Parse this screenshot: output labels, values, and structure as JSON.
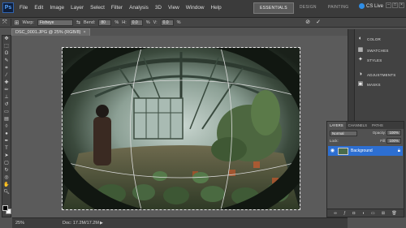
{
  "app": {
    "logo": "Ps"
  },
  "menu": [
    "File",
    "Edit",
    "Image",
    "Layer",
    "Select",
    "Filter",
    "Analysis",
    "3D",
    "View",
    "Window",
    "Help"
  ],
  "appbar_tools": {
    "zoom_value": "25%"
  },
  "workspaces": [
    "ESSENTIALS",
    "DESIGN",
    "PAINTING"
  ],
  "active_workspace": "ESSENTIALS",
  "cslive": {
    "label": "CS Live"
  },
  "options": {
    "warp_label": "Warp:",
    "warp_value": "Fisheye",
    "bend_label": "Bend:",
    "bend_value": "80",
    "bend_unit": "%",
    "h_label": "H:",
    "h_value": "0.0",
    "h_unit": "%",
    "v_label": "V:",
    "v_value": "0.0",
    "v_unit": "%"
  },
  "document": {
    "tab_title": "DSC_0001.JPG @ 25% (RGB/8)"
  },
  "status": {
    "zoom": "25%",
    "doc": "Doc: 17.2M/17.2M"
  },
  "panels": [
    "COLOR",
    "SWATCHES",
    "STYLES",
    "ADJUSTMENTS",
    "MASKS"
  ],
  "layers_panel": {
    "tabs": [
      "LAYERS",
      "CHANNELS",
      "PATHS"
    ],
    "blend_mode": "Normal",
    "opacity_label": "Opacity:",
    "opacity_value": "100%",
    "lock_label": "Lock:",
    "fill_label": "Fill:",
    "fill_value": "100%",
    "layer_name": "Background"
  },
  "colors": {
    "accent": "#2d6fd2",
    "fg_swatch": "#000000",
    "bg_swatch": "#ffffff"
  }
}
